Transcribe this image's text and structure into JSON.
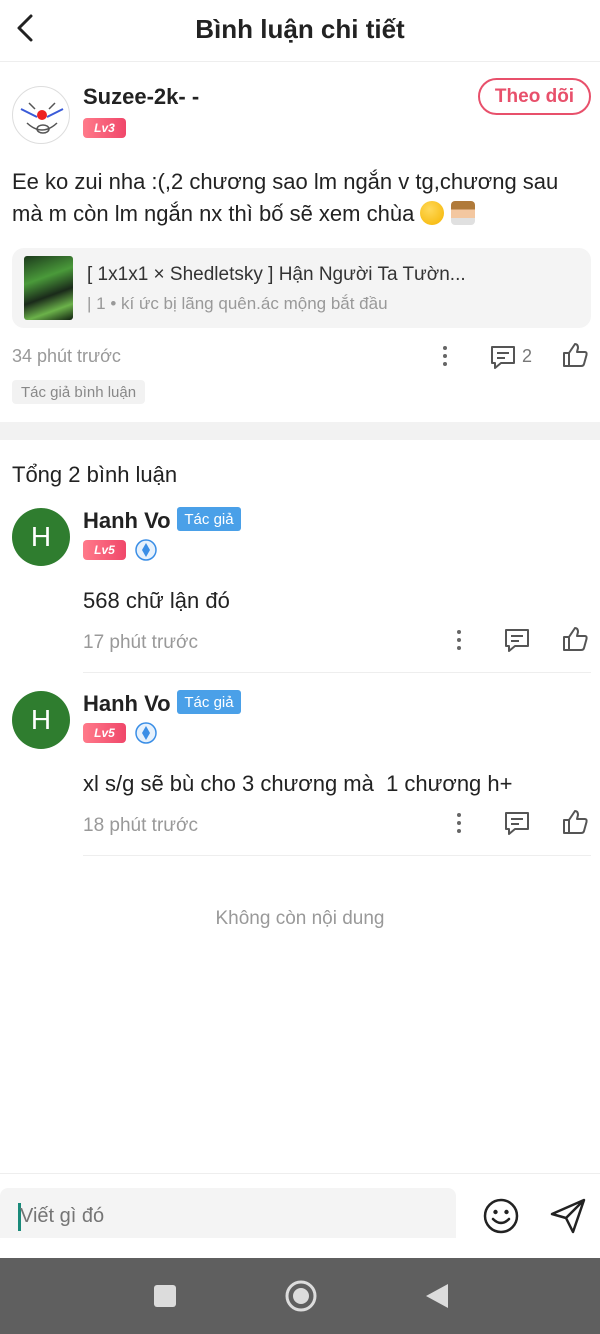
{
  "header": {
    "title": "Bình luận chi tiết"
  },
  "post": {
    "username": "Suzee-2k- -",
    "level": "Lv3",
    "follow_label": "Theo dõi",
    "text": "Ee ko zui nha :(,2 chương sao lm ngắn v tg,chương sau mà m còn lm ngắn nx thì bố sẽ xem chùa",
    "book_title": "[ 1x1x1 × Shedletsky ] Hận Người Ta Tườn...",
    "book_subtitle": "| 1 • kí ức bị lãng quên.ác mộng bắt đầu",
    "time": "34 phút trước",
    "comment_count": "2",
    "tag": "Tác giả bình luận"
  },
  "total_label": "Tổng 2 bình luận",
  "comments": [
    {
      "avatar_letter": "H",
      "name": "Hanh Vo",
      "author_tag": "Tác giả",
      "level": "Lv5",
      "text": "568 chữ lận đó",
      "time": "17 phút trước"
    },
    {
      "avatar_letter": "H",
      "name": "Hanh Vo",
      "author_tag": "Tác giả",
      "level": "Lv5",
      "text": "xl s/g sẽ bù cho 3 chương mà  1 chương h+",
      "time": "18 phút trước"
    }
  ],
  "end_text": "Không còn nội dung",
  "input": {
    "placeholder": "Viết gì đó"
  },
  "colors": {
    "accent": "#e8506b",
    "author_tag": "#4aa0e8",
    "avatar": "#2f7d2f"
  }
}
